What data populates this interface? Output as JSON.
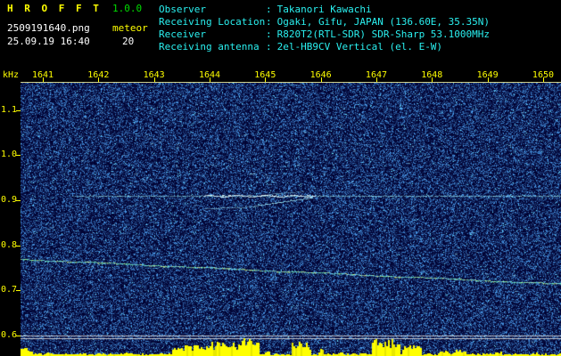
{
  "header": {
    "app_name": "H R O F F T",
    "version": "1.0.0",
    "filename": "2509191640.png",
    "mode_label": "meteor",
    "datetime": "25.09.19 16:40",
    "count": "20",
    "colon": ":",
    "info": [
      {
        "label": "Observer",
        "value": "Takanori Kawachi"
      },
      {
        "label": "Receiving Location",
        "value": "Ogaki, Gifu, JAPAN (136.60E, 35.35N)"
      },
      {
        "label": "Receiver",
        "value": "R820T2(RTL-SDR) SDR-Sharp 53.1000MHz"
      },
      {
        "label": "Receiving antenna",
        "value": "2el-HB9CV Vertical (el. E-W)"
      }
    ]
  },
  "chart_data": {
    "type": "heatmap",
    "subtype": "radio-meteor-spectrogram",
    "title": "",
    "ylabel": "kHz",
    "x_ticks": [
      "1641",
      "1642",
      "1643",
      "1644",
      "1645",
      "1646",
      "1647",
      "1648",
      "1649",
      "1650"
    ],
    "y_ticks": [
      "1.1",
      "1.0",
      "0.9",
      "0.8",
      "0.7",
      "0.6"
    ],
    "y_range_khz": [
      0.55,
      1.17
    ],
    "time_span": "16:41 - 16:50",
    "grid": false,
    "features": {
      "carrier_khz": 0.91,
      "carrier_bright_segment": {
        "x1": 0.34,
        "x2": 0.545
      },
      "drift_trace": {
        "start_khz": 0.77,
        "end_khz": 0.715
      },
      "faint_trace": {
        "start_khz": 1.05,
        "end_khz": 1.01,
        "alpha": 0.16
      },
      "echo_streaks": [
        {
          "x1": 0.432,
          "x2": 0.54,
          "khz1": 0.888,
          "khz2": 0.906,
          "alpha": 0.9
        },
        {
          "x1": 0.342,
          "x2": 0.432,
          "khz1": 0.882,
          "khz2": 0.886,
          "alpha": 0.55
        },
        {
          "x1": 0.457,
          "x2": 0.523,
          "khz1": 0.914,
          "khz2": 0.92,
          "alpha": 0.45
        }
      ],
      "reference_lines_khz": [
        0.6,
        0.594
      ]
    },
    "meter": {
      "baseline_level": 0.07,
      "activity": [
        {
          "from": 0.0,
          "to": 0.02,
          "level": 0.5
        },
        {
          "from": 0.045,
          "to": 0.055,
          "level": 0.2
        },
        {
          "from": 0.1,
          "to": 0.12,
          "level": 0.12
        },
        {
          "from": 0.19,
          "to": 0.21,
          "level": 0.15
        },
        {
          "from": 0.28,
          "to": 0.345,
          "level": 0.55
        },
        {
          "from": 0.345,
          "to": 0.4,
          "level": 0.72
        },
        {
          "from": 0.4,
          "to": 0.44,
          "level": 1.0
        },
        {
          "from": 0.452,
          "to": 0.462,
          "level": 0.3
        },
        {
          "from": 0.5,
          "to": 0.535,
          "level": 0.65
        },
        {
          "from": 0.548,
          "to": 0.558,
          "level": 0.35
        },
        {
          "from": 0.585,
          "to": 0.595,
          "level": 0.18
        },
        {
          "from": 0.65,
          "to": 0.7,
          "level": 0.85
        },
        {
          "from": 0.705,
          "to": 0.74,
          "level": 0.55
        },
        {
          "from": 0.775,
          "to": 0.79,
          "level": 0.22
        },
        {
          "from": 0.8,
          "to": 0.825,
          "level": 0.32
        },
        {
          "from": 0.875,
          "to": 0.89,
          "level": 0.18
        },
        {
          "from": 0.945,
          "to": 0.955,
          "level": 0.15
        }
      ]
    }
  },
  "colors": {
    "background": "#000000",
    "noise_base": "#000a38",
    "accent_yellow": "#ffff00",
    "text_white": "#ffffff",
    "text_cyan": "#2af0f0",
    "text_green": "#00dd00",
    "carrier": "#aaffff",
    "trace_green": "#66ffcc",
    "meter_yellow": "#ffff00",
    "reference_white": "#e0e0e0",
    "axis_line": "#cfcf8a"
  }
}
